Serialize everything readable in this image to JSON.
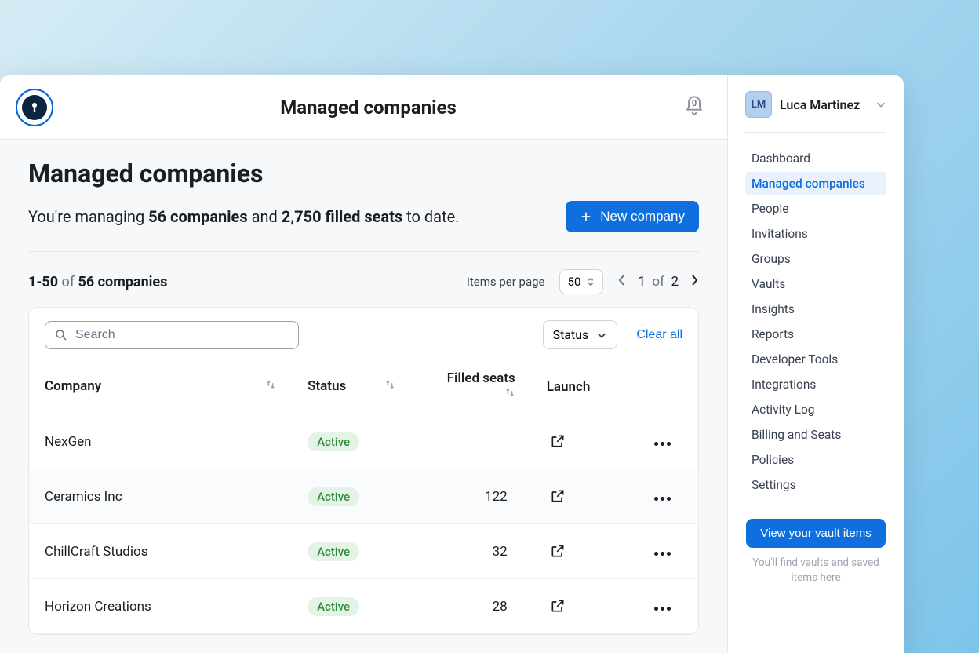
{
  "header": {
    "title": "Managed companies",
    "notifications": "0"
  },
  "page": {
    "title": "Managed companies",
    "summary_prefix": "You're managing ",
    "summary_companies": "56 companies",
    "summary_mid": " and ",
    "summary_seats": "2,750 filled seats",
    "summary_suffix": " to date.",
    "new_company_label": "New company"
  },
  "list": {
    "range": "1-50",
    "range_of": "of",
    "total": "56 companies",
    "items_per_page_label": "Items per page",
    "items_per_page_value": "50",
    "current_page": "1",
    "page_of": "of",
    "total_pages": "2"
  },
  "toolbar": {
    "search_placeholder": "Search",
    "status_filter_label": "Status",
    "clear_all_label": "Clear all"
  },
  "columns": {
    "company": "Company",
    "status": "Status",
    "filled_seats": "Filled seats",
    "launch": "Launch"
  },
  "rows": [
    {
      "company": "NexGen",
      "status": "Active",
      "seats": ""
    },
    {
      "company": "Ceramics Inc",
      "status": "Active",
      "seats": "122"
    },
    {
      "company": "ChillCraft Studios",
      "status": "Active",
      "seats": "32"
    },
    {
      "company": "Horizon Creations",
      "status": "Active",
      "seats": "28"
    }
  ],
  "user": {
    "initials": "LM",
    "name": "Luca Martinez"
  },
  "nav": {
    "items": [
      "Dashboard",
      "Managed companies",
      "People",
      "Invitations",
      "Groups",
      "Vaults",
      "Insights",
      "Reports",
      "Developer Tools",
      "Integrations",
      "Activity Log",
      "Billing and Seats",
      "Policies",
      "Settings"
    ],
    "active_index": 1
  },
  "vault": {
    "button": "View your vault items",
    "hint": "You'll find vaults and saved items here"
  }
}
